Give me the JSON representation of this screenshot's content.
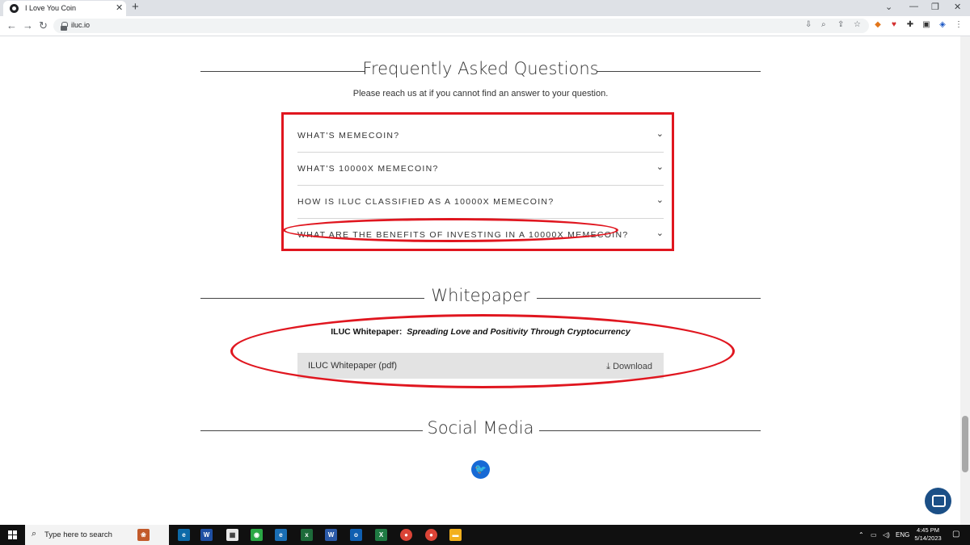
{
  "browser": {
    "tab_title": "I Love You Coin",
    "url": "iluc.io",
    "new_tab_label": "+",
    "tab_close_label": "✕"
  },
  "faq": {
    "heading": "Frequently Asked Questions",
    "subtitle": "Please reach us at  if you cannot find an answer to your question.",
    "items": [
      {
        "question": "WHAT'S MEMECOIN?"
      },
      {
        "question": "WHAT'S 10000X MEMECOIN?"
      },
      {
        "question": "HOW IS ILUC CLASSIFIED AS A 10000X MEMECOIN?"
      },
      {
        "question": "WHAT ARE THE BENEFITS OF INVESTING IN A 10000X MEMECOIN?"
      }
    ]
  },
  "whitepaper": {
    "heading": "Whitepaper",
    "label": "ILUC Whitepaper:",
    "tagline": "Spreading Love and Positivity Through Cryptocurrency",
    "file_name": "ILUC Whitepaper (pdf)",
    "download_label": "Download"
  },
  "social": {
    "heading": "Social Media",
    "icons": [
      "twitter-icon"
    ]
  },
  "annotations": {
    "color": "#e0161f"
  },
  "taskbar": {
    "search_placeholder": "Type here to search",
    "language": "ENG",
    "time": "4:45 PM",
    "date": "5/14/2023"
  }
}
